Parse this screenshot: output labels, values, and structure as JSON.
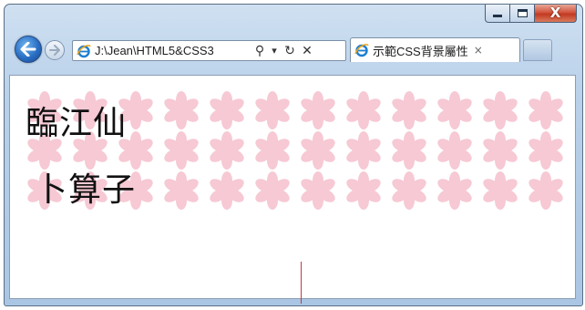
{
  "window": {
    "controls": {
      "minimize_icon": "minimize-icon",
      "maximize_icon": "maximize-icon",
      "close_symbol": "X"
    }
  },
  "toolbar": {
    "address_text": "J:\\Jean\\HTML5&CSS3",
    "search_symbol": "⚲",
    "dropdown_symbol": "▾",
    "refresh_symbol": "↻",
    "stop_symbol": "✕"
  },
  "tab": {
    "title": "示範CSS背景屬性",
    "close_symbol": "×"
  },
  "page": {
    "line1": "臨江仙",
    "line2": "卜算子"
  },
  "colors": {
    "accent": "#2a6fc4",
    "flower": "#f6c9d4",
    "cursor": "#c0394b"
  }
}
